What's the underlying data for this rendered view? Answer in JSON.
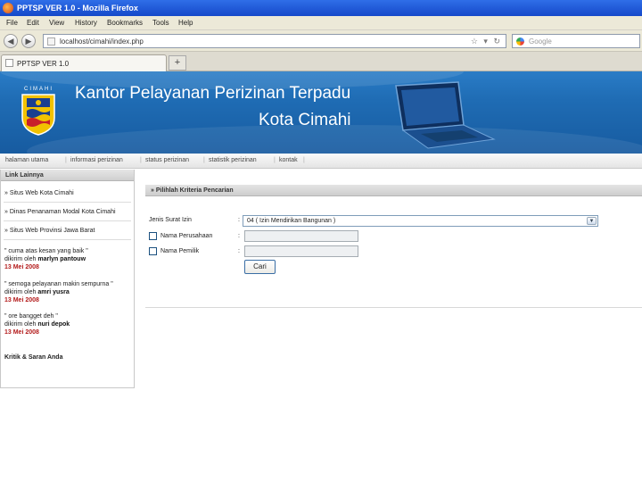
{
  "window": {
    "title": "PPTSP VER 1.0 - Mozilla Firefox"
  },
  "menu": [
    "File",
    "Edit",
    "View",
    "History",
    "Bookmarks",
    "Tools",
    "Help"
  ],
  "toolbar": {
    "url": "localhost/cimahi/index.php",
    "search_placeholder": "Google"
  },
  "tabs": [
    {
      "label": "PPTSP VER 1.0"
    }
  ],
  "header": {
    "city_label": "CIMAHI",
    "title_line1": "Kantor Pelayanan Perizinan Terpadu",
    "title_line2": "Kota Cimahi"
  },
  "site_nav": [
    "halaman utama",
    "informasi perizinan",
    "status perizinan",
    "statistik perizinan",
    "kontak"
  ],
  "sidebar": {
    "heading": "Link Lainnya",
    "links": [
      "» Situs Web Kota Cimahi",
      "» Dinas Penanaman Modal Kota Cimahi",
      "» Situs Web Provinsi Jawa Barat"
    ],
    "testimonials": [
      {
        "quote": "\" cuma atas kesan yang baik \"",
        "author_prefix": "dikirim oleh",
        "author": "marlyn pantouw",
        "date": "13 Mei 2008"
      },
      {
        "quote": "\" semoga pelayanan makin sempurna \"",
        "author_prefix": "dikirim oleh",
        "author": "amri yusra",
        "date": "13 Mei 2008"
      },
      {
        "quote": "\" ore bangget deh \"",
        "author_prefix": "dikirim oleh",
        "author": "nuri depok",
        "date": "13 Mei 2008"
      }
    ],
    "kritik": "Kritik & Saran Anda"
  },
  "form": {
    "heading": "» Pilihlah Kriteria Pencarian",
    "jenis_label": "Jenis Surat Izin",
    "jenis_value": "04 ( Izin Mendirikan Bangunan )",
    "perusahaan_label": "Nama Perusahaan",
    "pemilik_label": "Nama Pemilik",
    "colon": ":",
    "submit_label": "Cari"
  }
}
